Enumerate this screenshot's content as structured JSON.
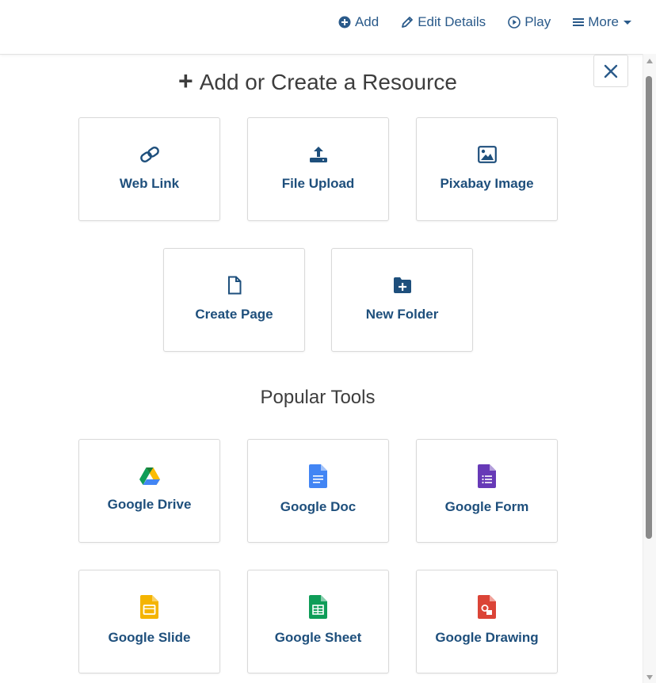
{
  "nav": {
    "add": "Add",
    "edit": "Edit Details",
    "play": "Play",
    "more": "More"
  },
  "modal": {
    "title": "Add or Create a Resource",
    "popular_title": "Popular Tools"
  },
  "resources": [
    {
      "label": "Web Link",
      "icon": "link-icon"
    },
    {
      "label": "File Upload",
      "icon": "upload-icon"
    },
    {
      "label": "Pixabay Image",
      "icon": "image-icon"
    },
    {
      "label": "Create Page",
      "icon": "file-icon"
    },
    {
      "label": "New Folder",
      "icon": "folder-plus-icon"
    }
  ],
  "tools": [
    {
      "label": "Google Drive",
      "icon": "google-drive-icon"
    },
    {
      "label": "Google Doc",
      "icon": "google-doc-icon",
      "color": "#4285f4"
    },
    {
      "label": "Google Form",
      "icon": "google-form-icon",
      "color": "#673ab7"
    },
    {
      "label": "Google Slide",
      "icon": "google-slide-icon",
      "color": "#f4b400"
    },
    {
      "label": "Google Sheet",
      "icon": "google-sheet-icon",
      "color": "#0f9d58"
    },
    {
      "label": "Google Drawing",
      "icon": "google-drawing-icon",
      "color": "#db4437"
    }
  ],
  "colors": {
    "link": "#1e4f7c",
    "heading": "#3d3d3d"
  }
}
